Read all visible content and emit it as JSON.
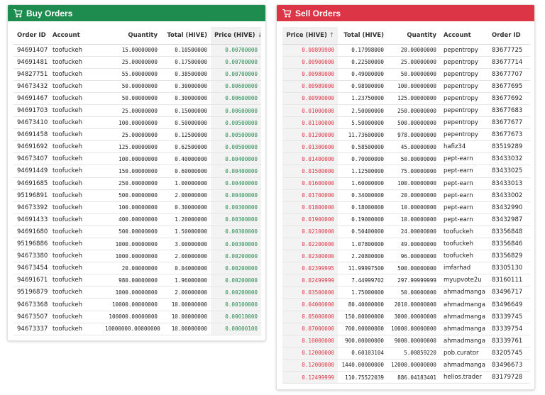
{
  "buy": {
    "title": "Buy Orders",
    "icon": "cart-icon",
    "accent": "#1e8b4f",
    "columns": {
      "order_id": "Order ID",
      "account": "Account",
      "quantity": "Quantity",
      "total": "Total (HIVE)",
      "price": "Price (HIVE)",
      "sort_arrow": "↓"
    },
    "rows": [
      {
        "order_id": "94691407",
        "account": "toofuckeh",
        "quantity": "15.00000000",
        "total": "0.10500000",
        "price": "0.00700000"
      },
      {
        "order_id": "94691481",
        "account": "toofuckeh",
        "quantity": "25.00000000",
        "total": "0.17500000",
        "price": "0.00700000"
      },
      {
        "order_id": "94827751",
        "account": "toofuckeh",
        "quantity": "55.00000000",
        "total": "0.38500000",
        "price": "0.00700000"
      },
      {
        "order_id": "94673432",
        "account": "toofuckeh",
        "quantity": "50.00000000",
        "total": "0.30000000",
        "price": "0.00600000"
      },
      {
        "order_id": "94691467",
        "account": "toofuckeh",
        "quantity": "50.00000000",
        "total": "0.30000000",
        "price": "0.00600000"
      },
      {
        "order_id": "94691703",
        "account": "toofuckeh",
        "quantity": "25.00000000",
        "total": "0.15000000",
        "price": "0.00600000"
      },
      {
        "order_id": "94673410",
        "account": "toofuckeh",
        "quantity": "100.00000000",
        "total": "0.50000000",
        "price": "0.00500000"
      },
      {
        "order_id": "94691458",
        "account": "toofuckeh",
        "quantity": "25.00000000",
        "total": "0.12500000",
        "price": "0.00500000"
      },
      {
        "order_id": "94691692",
        "account": "toofuckeh",
        "quantity": "125.00000000",
        "total": "0.62500000",
        "price": "0.00500000"
      },
      {
        "order_id": "94673407",
        "account": "toofuckeh",
        "quantity": "100.00000000",
        "total": "0.40000000",
        "price": "0.00400000"
      },
      {
        "order_id": "94691449",
        "account": "toofuckeh",
        "quantity": "150.00000000",
        "total": "0.60000000",
        "price": "0.00400000"
      },
      {
        "order_id": "94691685",
        "account": "toofuckeh",
        "quantity": "250.00000000",
        "total": "1.00000000",
        "price": "0.00400000"
      },
      {
        "order_id": "95196891",
        "account": "toofuckeh",
        "quantity": "500.00000000",
        "total": "2.00000000",
        "price": "0.00400000"
      },
      {
        "order_id": "94673392",
        "account": "toofuckeh",
        "quantity": "100.00000000",
        "total": "0.30000000",
        "price": "0.00300000"
      },
      {
        "order_id": "94691433",
        "account": "toofuckeh",
        "quantity": "400.00000000",
        "total": "1.20000000",
        "price": "0.00300000"
      },
      {
        "order_id": "94691680",
        "account": "toofuckeh",
        "quantity": "500.00000000",
        "total": "1.50000000",
        "price": "0.00300000"
      },
      {
        "order_id": "95196886",
        "account": "toofuckeh",
        "quantity": "1000.00000000",
        "total": "3.00000000",
        "price": "0.00300000"
      },
      {
        "order_id": "94673380",
        "account": "toofuckeh",
        "quantity": "1000.00000000",
        "total": "2.00000000",
        "price": "0.00200000"
      },
      {
        "order_id": "94673454",
        "account": "toofuckeh",
        "quantity": "20.00000000",
        "total": "0.04000000",
        "price": "0.00200000"
      },
      {
        "order_id": "94691671",
        "account": "toofuckeh",
        "quantity": "980.00000000",
        "total": "1.96000000",
        "price": "0.00200000"
      },
      {
        "order_id": "95196879",
        "account": "toofuckeh",
        "quantity": "1000.00000000",
        "total": "2.00000000",
        "price": "0.00200000"
      },
      {
        "order_id": "94673368",
        "account": "toofuckeh",
        "quantity": "10000.00000000",
        "total": "10.00000000",
        "price": "0.00100000"
      },
      {
        "order_id": "94673507",
        "account": "toofuckeh",
        "quantity": "100000.00000000",
        "total": "10.00000000",
        "price": "0.00010000"
      },
      {
        "order_id": "94673337",
        "account": "toofuckeh",
        "quantity": "10000000.00000000",
        "total": "10.00000000",
        "price": "0.00000100"
      }
    ]
  },
  "sell": {
    "title": "Sell Orders",
    "icon": "cart-icon",
    "accent": "#dc3545",
    "columns": {
      "price": "Price (HIVE)",
      "total": "Total (HIVE)",
      "quantity": "Quantity",
      "account": "Account",
      "order_id": "Order ID",
      "sort_arrow": "↑"
    },
    "rows": [
      {
        "price": "0.00899900",
        "total": "0.17998000",
        "quantity": "20.00000000",
        "account": "pepentropy",
        "order_id": "83677725"
      },
      {
        "price": "0.00900000",
        "total": "0.22500000",
        "quantity": "25.00000000",
        "account": "pepentropy",
        "order_id": "83677714"
      },
      {
        "price": "0.00980000",
        "total": "0.49000000",
        "quantity": "50.00000000",
        "account": "pepentropy",
        "order_id": "83677707"
      },
      {
        "price": "0.00989000",
        "total": "0.98900000",
        "quantity": "100.00000000",
        "account": "pepentropy",
        "order_id": "83677695"
      },
      {
        "price": "0.00990000",
        "total": "1.23750000",
        "quantity": "125.00000000",
        "account": "pepentropy",
        "order_id": "83677692"
      },
      {
        "price": "0.01000000",
        "total": "2.50000000",
        "quantity": "250.00000000",
        "account": "pepentropy",
        "order_id": "83677683"
      },
      {
        "price": "0.01100000",
        "total": "5.50000000",
        "quantity": "500.00000000",
        "account": "pepentropy",
        "order_id": "83677677"
      },
      {
        "price": "0.01200000",
        "total": "11.73600000",
        "quantity": "978.00000000",
        "account": "pepentropy",
        "order_id": "83677673"
      },
      {
        "price": "0.01300000",
        "total": "0.58500000",
        "quantity": "45.00000000",
        "account": "hafiz34",
        "order_id": "83519289"
      },
      {
        "price": "0.01400000",
        "total": "0.70000000",
        "quantity": "50.00000000",
        "account": "pept-earn",
        "order_id": "83433032"
      },
      {
        "price": "0.01500000",
        "total": "1.12500000",
        "quantity": "75.00000000",
        "account": "pept-earn",
        "order_id": "83433025"
      },
      {
        "price": "0.01600000",
        "total": "1.60000000",
        "quantity": "100.00000000",
        "account": "pept-earn",
        "order_id": "83433013"
      },
      {
        "price": "0.01700000",
        "total": "0.34000000",
        "quantity": "20.00000000",
        "account": "pept-earn",
        "order_id": "83433002"
      },
      {
        "price": "0.01800000",
        "total": "0.18000000",
        "quantity": "10.00000000",
        "account": "pept-earn",
        "order_id": "83432990"
      },
      {
        "price": "0.01900000",
        "total": "0.19000000",
        "quantity": "10.00000000",
        "account": "pept-earn",
        "order_id": "83432987"
      },
      {
        "price": "0.02100000",
        "total": "0.50400000",
        "quantity": "24.00000000",
        "account": "toofuckeh",
        "order_id": "83356848"
      },
      {
        "price": "0.02200000",
        "total": "1.07800000",
        "quantity": "49.00000000",
        "account": "toofuckeh",
        "order_id": "83356846"
      },
      {
        "price": "0.02300000",
        "total": "2.20800000",
        "quantity": "96.00000000",
        "account": "toofuckeh",
        "order_id": "83356829"
      },
      {
        "price": "0.02399995",
        "total": "11.99997500",
        "quantity": "500.00000000",
        "account": "imfarhad",
        "order_id": "83305130"
      },
      {
        "price": "0.02499999",
        "total": "7.44999702",
        "quantity": "297.99999999",
        "account": "myupvote2u",
        "order_id": "83160111"
      },
      {
        "price": "0.03500000",
        "total": "1.75000000",
        "quantity": "50.00000000",
        "account": "ahmadmanga",
        "order_id": "83496717"
      },
      {
        "price": "0.04000000",
        "total": "80.40000000",
        "quantity": "2010.00000000",
        "account": "ahmadmanga",
        "order_id": "83496649"
      },
      {
        "price": "0.05000000",
        "total": "150.00000000",
        "quantity": "3000.00000000",
        "account": "ahmadmanga",
        "order_id": "83339745"
      },
      {
        "price": "0.07000000",
        "total": "700.00000000",
        "quantity": "10000.00000000",
        "account": "ahmadmanga",
        "order_id": "83339754"
      },
      {
        "price": "0.10000000",
        "total": "900.00000000",
        "quantity": "9000.00000000",
        "account": "ahmadmanga",
        "order_id": "83339761"
      },
      {
        "price": "0.12000000",
        "total": "0.60103104",
        "quantity": "5.00859220",
        "account": "pob.curator",
        "order_id": "83205745"
      },
      {
        "price": "0.12000000",
        "total": "1440.00000000",
        "quantity": "12000.00000000",
        "account": "ahmadmanga",
        "order_id": "83496673"
      },
      {
        "price": "0.12499999",
        "total": "110.75522039",
        "quantity": "886.04183401",
        "account": "helios.trader",
        "order_id": "83179728"
      }
    ]
  }
}
